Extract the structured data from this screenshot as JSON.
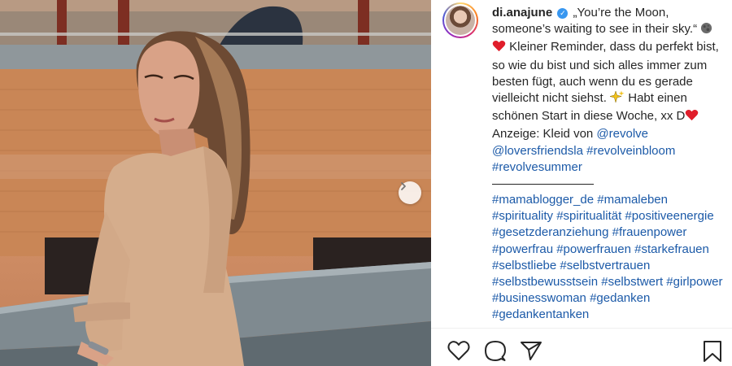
{
  "post": {
    "username": "di.anajune",
    "caption_quote": "„You’re the Moon, someone’s waiting to see in their sky.“",
    "caption_body_1": "Kleiner Reminder, dass du perfekt bist, so wie du bist und sich alles immer zum besten fügt, auch wenn du es gerade vielleicht nicht siehst.",
    "caption_body_2": "Habt einen schönen Start in diese Woche, xx D",
    "caption_body_3": "Anzeige: Kleid von",
    "mention_1": "@revolve",
    "mention_2": "@loversfriendsla",
    "tags_top": [
      "#revolveinbloom",
      "#revolvesummer"
    ],
    "hashtags": [
      "#mamablogger_de",
      "#mamaleben",
      "#spirituality",
      "#spiritualität",
      "#positiveenergie",
      "#gesetzderanziehung",
      "#frauenpower",
      "#powerfrau",
      "#powerfrauen",
      "#starkefrauen",
      "#selbstliebe",
      "#selbstvertrauen",
      "#selbstbewusstsein",
      "#selbstwert",
      "#girlpower",
      "#businesswoman",
      "#gedanken",
      "#gedankentanken"
    ]
  },
  "icons": {
    "verified": "verified-badge-icon",
    "moon": "moon-emoji-icon",
    "heart": "red-heart-emoji-icon",
    "sparkles": "sparkles-emoji-icon",
    "next": "chevron-right-icon",
    "like": "heart-outline-icon",
    "comment": "comment-icon",
    "share": "paper-plane-icon",
    "save": "bookmark-icon"
  },
  "colors": {
    "link": "#1c5aa8",
    "verified": "#3897f0",
    "text": "#262626"
  }
}
